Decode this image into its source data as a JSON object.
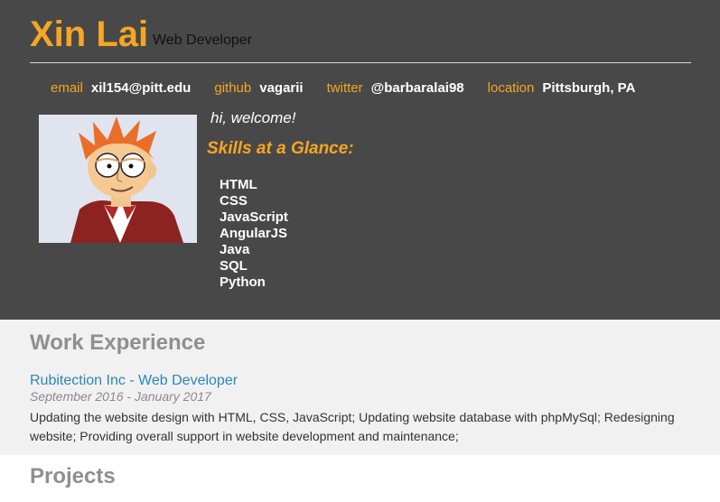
{
  "header": {
    "name": "Xin Lai",
    "role": "Web Developer"
  },
  "contact": [
    {
      "key": "email",
      "value": "xil154@pitt.edu"
    },
    {
      "key": "github",
      "value": "vagarii"
    },
    {
      "key": "twitter",
      "value": "@barbaralai98"
    },
    {
      "key": "location",
      "value": "Pittsburgh, PA"
    }
  ],
  "intro": {
    "welcome": "hi, welcome!",
    "skills_title": "Skills at a Glance:",
    "skills": [
      "HTML",
      "CSS",
      "JavaScript",
      "AngularJS",
      "Java",
      "SQL",
      "Python"
    ]
  },
  "work": {
    "title": "Work Experience",
    "job_title": "Rubitection Inc - Web Developer",
    "dates": "September 2016 - January 2017",
    "description": "Updating the website design with HTML, CSS, JavaScript; Updating website database with phpMySql; Redesigning website; Providing overall support in website development and maintenance;"
  },
  "projects": {
    "title": "Projects"
  },
  "colors": {
    "accent": "#f5a623",
    "header_bg": "#484848",
    "link": "#2b86b8"
  }
}
